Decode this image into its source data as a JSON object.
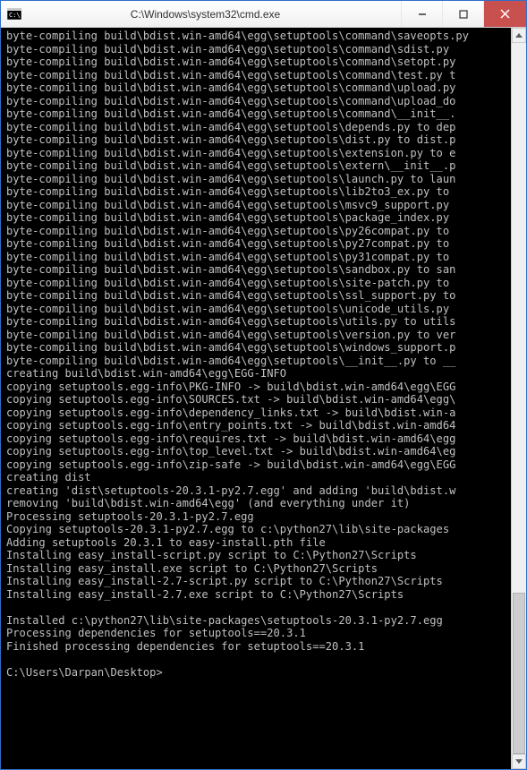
{
  "window": {
    "title": "C:\\Windows\\system32\\cmd.exe"
  },
  "terminal": {
    "lines": [
      "byte-compiling build\\bdist.win-amd64\\egg\\setuptools\\command\\saveopts.py",
      "byte-compiling build\\bdist.win-amd64\\egg\\setuptools\\command\\sdist.py ",
      "byte-compiling build\\bdist.win-amd64\\egg\\setuptools\\command\\setopt.py",
      "byte-compiling build\\bdist.win-amd64\\egg\\setuptools\\command\\test.py t",
      "byte-compiling build\\bdist.win-amd64\\egg\\setuptools\\command\\upload.py",
      "byte-compiling build\\bdist.win-amd64\\egg\\setuptools\\command\\upload_do",
      "byte-compiling build\\bdist.win-amd64\\egg\\setuptools\\command\\__init__.",
      "byte-compiling build\\bdist.win-amd64\\egg\\setuptools\\depends.py to dep",
      "byte-compiling build\\bdist.win-amd64\\egg\\setuptools\\dist.py to dist.p",
      "byte-compiling build\\bdist.win-amd64\\egg\\setuptools\\extension.py to e",
      "byte-compiling build\\bdist.win-amd64\\egg\\setuptools\\extern\\__init__.p",
      "byte-compiling build\\bdist.win-amd64\\egg\\setuptools\\launch.py to laun",
      "byte-compiling build\\bdist.win-amd64\\egg\\setuptools\\lib2to3_ex.py to ",
      "byte-compiling build\\bdist.win-amd64\\egg\\setuptools\\msvc9_support.py ",
      "byte-compiling build\\bdist.win-amd64\\egg\\setuptools\\package_index.py ",
      "byte-compiling build\\bdist.win-amd64\\egg\\setuptools\\py26compat.py to ",
      "byte-compiling build\\bdist.win-amd64\\egg\\setuptools\\py27compat.py to ",
      "byte-compiling build\\bdist.win-amd64\\egg\\setuptools\\py31compat.py to ",
      "byte-compiling build\\bdist.win-amd64\\egg\\setuptools\\sandbox.py to san",
      "byte-compiling build\\bdist.win-amd64\\egg\\setuptools\\site-patch.py to ",
      "byte-compiling build\\bdist.win-amd64\\egg\\setuptools\\ssl_support.py to",
      "byte-compiling build\\bdist.win-amd64\\egg\\setuptools\\unicode_utils.py ",
      "byte-compiling build\\bdist.win-amd64\\egg\\setuptools\\utils.py to utils",
      "byte-compiling build\\bdist.win-amd64\\egg\\setuptools\\version.py to ver",
      "byte-compiling build\\bdist.win-amd64\\egg\\setuptools\\windows_support.p",
      "byte-compiling build\\bdist.win-amd64\\egg\\setuptools\\__init__.py to __",
      "creating build\\bdist.win-amd64\\egg\\EGG-INFO",
      "copying setuptools.egg-info\\PKG-INFO -> build\\bdist.win-amd64\\egg\\EGG",
      "copying setuptools.egg-info\\SOURCES.txt -> build\\bdist.win-amd64\\egg\\",
      "copying setuptools.egg-info\\dependency_links.txt -> build\\bdist.win-a",
      "copying setuptools.egg-info\\entry_points.txt -> build\\bdist.win-amd64",
      "copying setuptools.egg-info\\requires.txt -> build\\bdist.win-amd64\\egg",
      "copying setuptools.egg-info\\top_level.txt -> build\\bdist.win-amd64\\eg",
      "copying setuptools.egg-info\\zip-safe -> build\\bdist.win-amd64\\egg\\EGG",
      "creating dist",
      "creating 'dist\\setuptools-20.3.1-py2.7.egg' and adding 'build\\bdist.w",
      "removing 'build\\bdist.win-amd64\\egg' (and everything under it)",
      "Processing setuptools-20.3.1-py2.7.egg",
      "Copying setuptools-20.3.1-py2.7.egg to c:\\python27\\lib\\site-packages",
      "Adding setuptools 20.3.1 to easy-install.pth file",
      "Installing easy_install-script.py script to C:\\Python27\\Scripts",
      "Installing easy_install.exe script to C:\\Python27\\Scripts",
      "Installing easy_install-2.7-script.py script to C:\\Python27\\Scripts",
      "Installing easy_install-2.7.exe script to C:\\Python27\\Scripts",
      "",
      "Installed c:\\python27\\lib\\site-packages\\setuptools-20.3.1-py2.7.egg",
      "Processing dependencies for setuptools==20.3.1",
      "Finished processing dependencies for setuptools==20.3.1",
      "",
      "C:\\Users\\Darpan\\Desktop>"
    ]
  }
}
